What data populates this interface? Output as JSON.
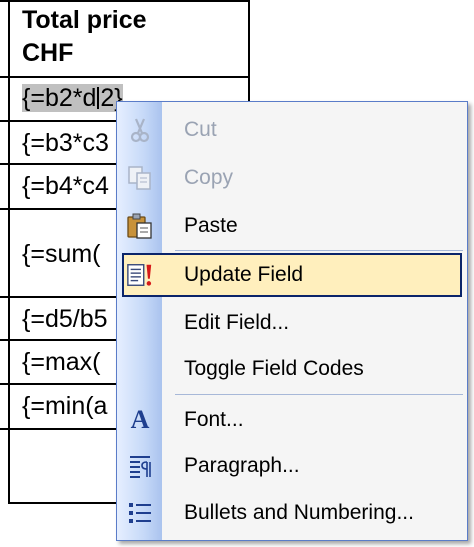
{
  "table": {
    "header_line1": "Total price",
    "header_line2": "CHF",
    "rows": [
      {
        "text": "{=b2*d2}"
      },
      {
        "text": "{=b3*c3"
      },
      {
        "text": "{=b4*c4"
      },
      {
        "text": "{=sum("
      },
      {
        "text": "{=d5/b5"
      },
      {
        "text": "{=max("
      },
      {
        "text": "{=min(a"
      }
    ]
  },
  "row1": {
    "pre": "{=b2*d",
    "post": "2}"
  },
  "context_menu": {
    "items": [
      {
        "label": "Cut",
        "icon": "scissors-icon",
        "disabled": true
      },
      {
        "label": "Copy",
        "icon": "copy-icon",
        "disabled": true
      },
      {
        "label": "Paste",
        "icon": "clipboard-paste-icon",
        "disabled": false
      },
      {
        "label": "Update Field",
        "icon": "update-field-icon",
        "disabled": false,
        "highlighted": true
      },
      {
        "label": "Edit Field...",
        "icon": "",
        "disabled": false
      },
      {
        "label": "Toggle Field Codes",
        "icon": "",
        "disabled": false
      },
      {
        "label": "Font...",
        "icon": "font-icon",
        "disabled": false
      },
      {
        "label": "Paragraph...",
        "icon": "paragraph-icon",
        "disabled": false
      },
      {
        "label": "Bullets and Numbering...",
        "icon": "bullets-icon",
        "disabled": false
      }
    ]
  },
  "colors": {
    "highlight_bg": "#ffefbd",
    "highlight_border": "#0a246a",
    "gutter": "#c6d9f8",
    "disabled_text": "#9aa3b3"
  }
}
